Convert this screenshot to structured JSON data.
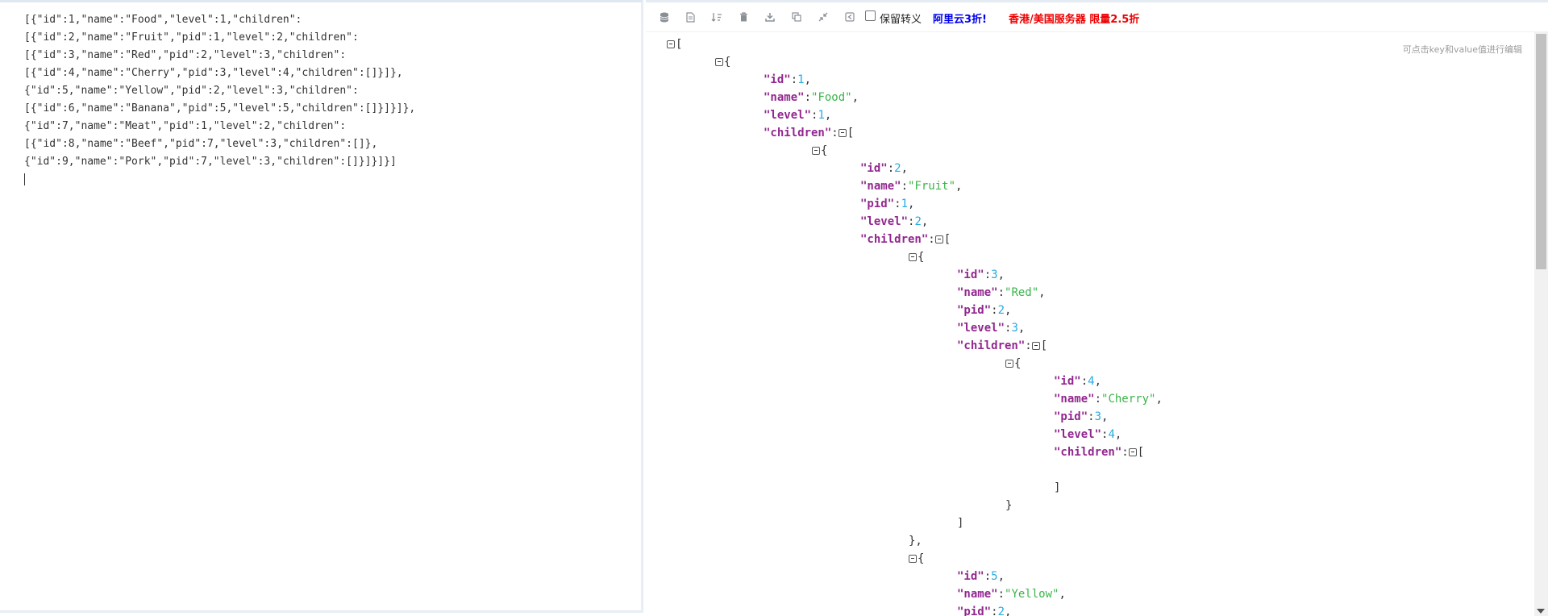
{
  "left": {
    "lines": [
      "[{\"id\":1,\"name\":\"Food\",\"level\":1,\"children\":",
      "[{\"id\":2,\"name\":\"Fruit\",\"pid\":1,\"level\":2,\"children\":",
      "[{\"id\":3,\"name\":\"Red\",\"pid\":2,\"level\":3,\"children\":",
      "[{\"id\":4,\"name\":\"Cherry\",\"pid\":3,\"level\":4,\"children\":[]}]},",
      "{\"id\":5,\"name\":\"Yellow\",\"pid\":2,\"level\":3,\"children\":",
      "[{\"id\":6,\"name\":\"Banana\",\"pid\":5,\"level\":5,\"children\":[]}]}]},",
      "{\"id\":7,\"name\":\"Meat\",\"pid\":1,\"level\":2,\"children\":",
      "[{\"id\":8,\"name\":\"Beef\",\"pid\":7,\"level\":3,\"children\":[]},",
      "{\"id\":9,\"name\":\"Pork\",\"pid\":7,\"level\":3,\"children\":[]}]}]}]"
    ]
  },
  "toolbar": {
    "icons": [
      "database-icon",
      "document-icon",
      "sort-icon",
      "trash-icon",
      "download-icon",
      "copy-icon",
      "compress-icon",
      "share-icon"
    ],
    "escape_label": "保留转义",
    "promo1": "阿里云3折!",
    "promo2": "香港/美国服务器 限量2.5折"
  },
  "hint": "可点击key和value值进行编辑",
  "tree": [
    {
      "d": 0,
      "t": "open",
      "tog": true,
      "b": "["
    },
    {
      "d": 1,
      "t": "open",
      "tog": true,
      "b": "{"
    },
    {
      "d": 2,
      "t": "kv",
      "k": "id",
      "v": "1",
      "vt": "num",
      "c": true
    },
    {
      "d": 2,
      "t": "kv",
      "k": "name",
      "v": "Food",
      "vt": "str",
      "c": true
    },
    {
      "d": 2,
      "t": "kv",
      "k": "level",
      "v": "1",
      "vt": "num",
      "c": true
    },
    {
      "d": 2,
      "t": "kopen",
      "k": "children",
      "b": "["
    },
    {
      "d": 3,
      "t": "open",
      "tog": true,
      "b": "{"
    },
    {
      "d": 4,
      "t": "kv",
      "k": "id",
      "v": "2",
      "vt": "num",
      "c": true
    },
    {
      "d": 4,
      "t": "kv",
      "k": "name",
      "v": "Fruit",
      "vt": "str",
      "c": true
    },
    {
      "d": 4,
      "t": "kv",
      "k": "pid",
      "v": "1",
      "vt": "num",
      "c": true
    },
    {
      "d": 4,
      "t": "kv",
      "k": "level",
      "v": "2",
      "vt": "num",
      "c": true
    },
    {
      "d": 4,
      "t": "kopen",
      "k": "children",
      "b": "["
    },
    {
      "d": 5,
      "t": "open",
      "tog": true,
      "b": "{"
    },
    {
      "d": 6,
      "t": "kv",
      "k": "id",
      "v": "3",
      "vt": "num",
      "c": true
    },
    {
      "d": 6,
      "t": "kv",
      "k": "name",
      "v": "Red",
      "vt": "str",
      "c": true
    },
    {
      "d": 6,
      "t": "kv",
      "k": "pid",
      "v": "2",
      "vt": "num",
      "c": true
    },
    {
      "d": 6,
      "t": "kv",
      "k": "level",
      "v": "3",
      "vt": "num",
      "c": true
    },
    {
      "d": 6,
      "t": "kopen",
      "k": "children",
      "b": "["
    },
    {
      "d": 7,
      "t": "open",
      "tog": true,
      "b": "{"
    },
    {
      "d": 8,
      "t": "kv",
      "k": "id",
      "v": "4",
      "vt": "num",
      "c": true
    },
    {
      "d": 8,
      "t": "kv",
      "k": "name",
      "v": "Cherry",
      "vt": "str",
      "c": true
    },
    {
      "d": 8,
      "t": "kv",
      "k": "pid",
      "v": "3",
      "vt": "num",
      "c": true
    },
    {
      "d": 8,
      "t": "kv",
      "k": "level",
      "v": "4",
      "vt": "num",
      "c": true
    },
    {
      "d": 8,
      "t": "kopen",
      "k": "children",
      "b": "["
    },
    {
      "d": 8,
      "t": "empty"
    },
    {
      "d": 8,
      "t": "close",
      "b": "]"
    },
    {
      "d": 7,
      "t": "close",
      "b": "}"
    },
    {
      "d": 6,
      "t": "close",
      "b": "]"
    },
    {
      "d": 5,
      "t": "close",
      "b": "},"
    },
    {
      "d": 5,
      "t": "open",
      "tog": true,
      "b": "{"
    },
    {
      "d": 6,
      "t": "kv",
      "k": "id",
      "v": "5",
      "vt": "num",
      "c": true
    },
    {
      "d": 6,
      "t": "kv",
      "k": "name",
      "v": "Yellow",
      "vt": "str",
      "c": true
    },
    {
      "d": 6,
      "t": "kv",
      "k": "pid",
      "v": "2",
      "vt": "num",
      "c": true
    }
  ]
}
